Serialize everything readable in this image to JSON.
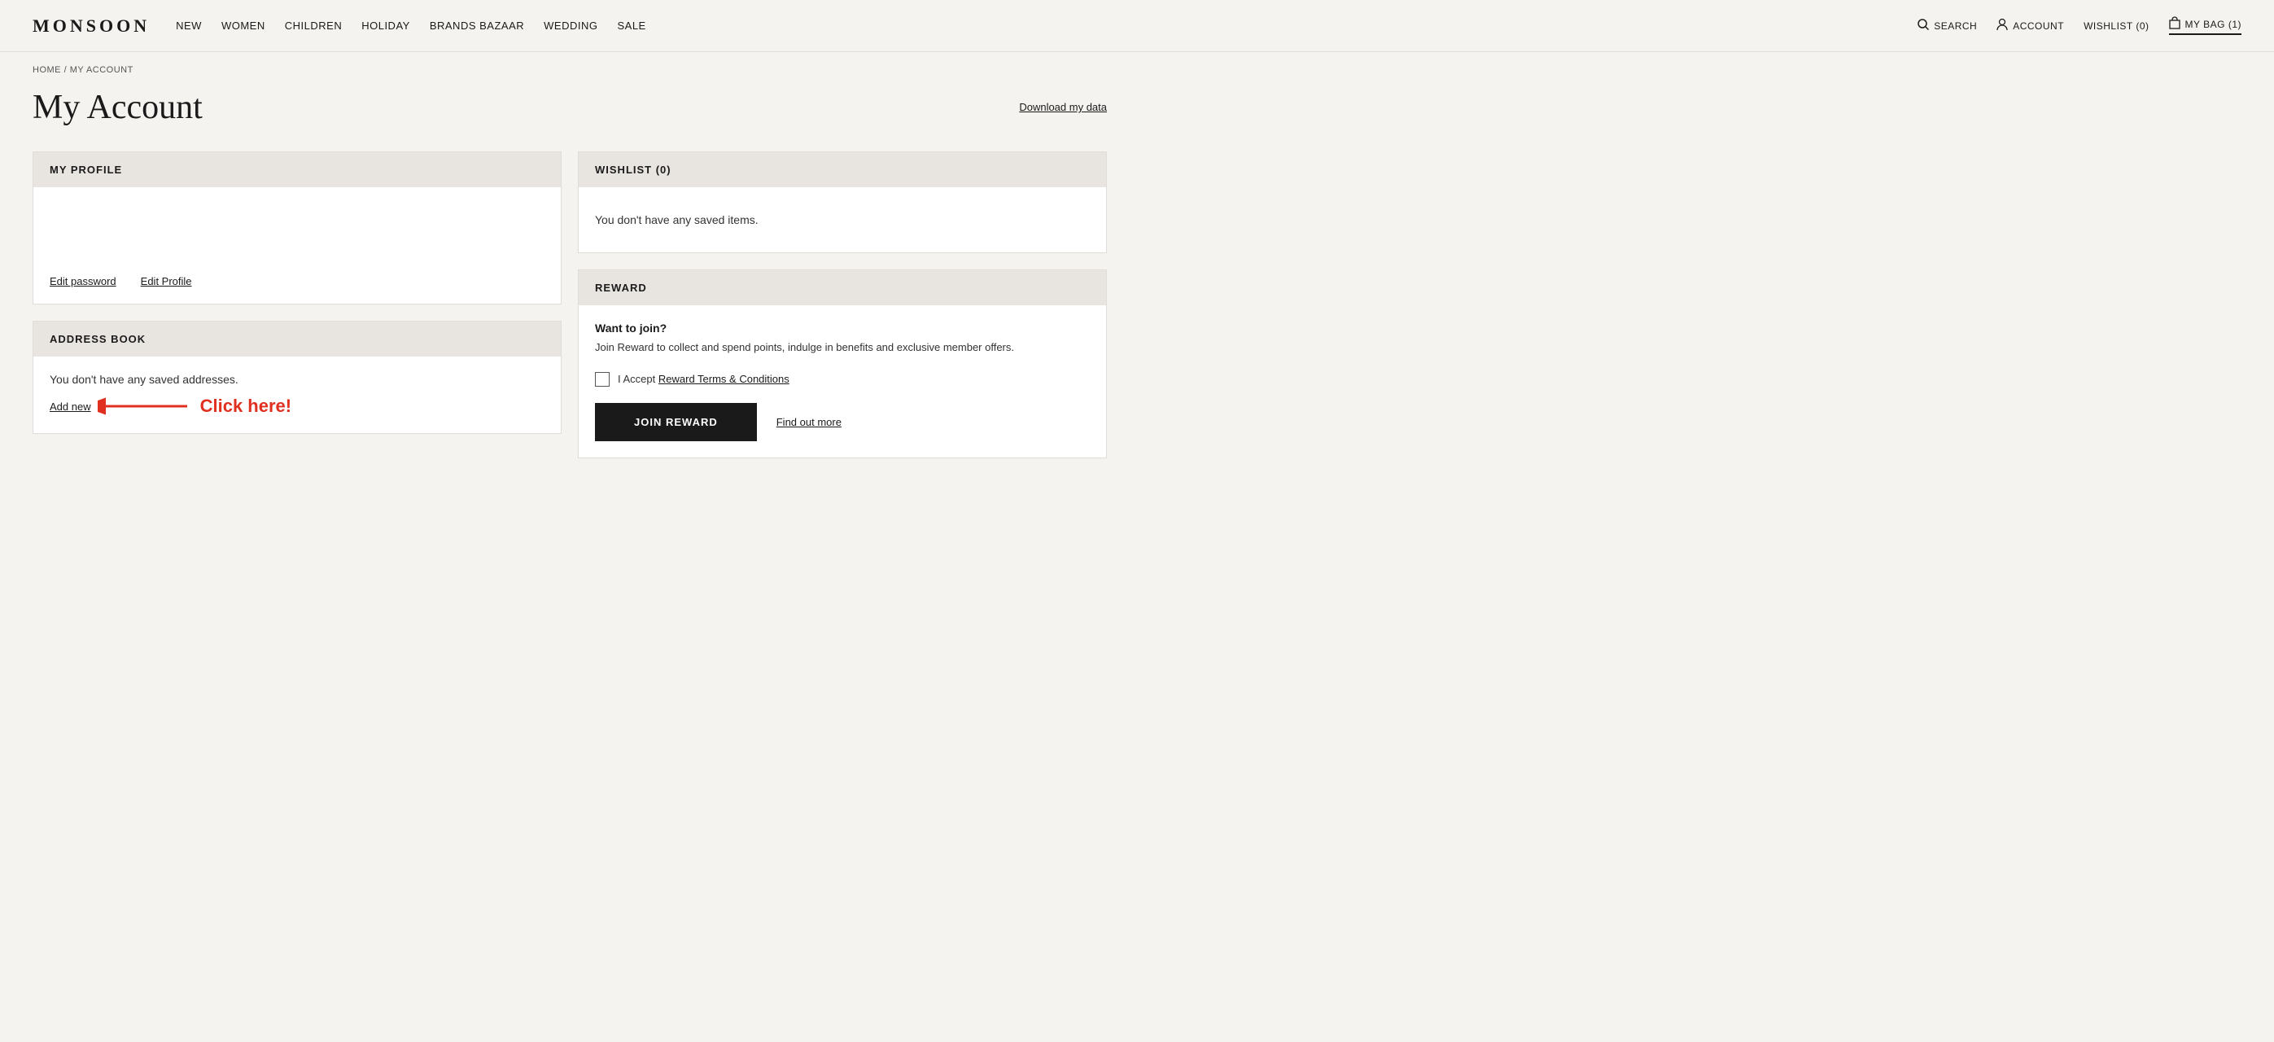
{
  "header": {
    "logo": "MONSOON",
    "nav_items": [
      "NEW",
      "WOMEN",
      "CHILDREN",
      "HOLIDAY",
      "BRANDS BAZAAR",
      "WEDDING",
      "SALE"
    ],
    "search_label": "SEARCH",
    "account_label": "ACCOUNT",
    "wishlist_label": "WISHLIST (0)",
    "bag_label": "MY BAG (1)"
  },
  "breadcrumb": {
    "home": "HOME",
    "separator": "/",
    "current": "MY ACCOUNT"
  },
  "page": {
    "title": "My Account",
    "download_link": "Download my data"
  },
  "profile_section": {
    "header": "MY PROFILE",
    "edit_password_label": "Edit password",
    "edit_profile_label": "Edit Profile"
  },
  "wishlist_section": {
    "header": "WISHLIST (0)",
    "empty_message": "You don't have any saved items."
  },
  "address_section": {
    "header": "ADDRESS BOOK",
    "empty_message": "You don't have any saved addresses.",
    "add_new_label": "Add new",
    "click_annotation": "Click here!"
  },
  "reward_section": {
    "header": "REWARD",
    "want_to_join": "Want to join?",
    "description": "Join Reward to collect and spend points, indulge in benefits and exclusive member offers.",
    "checkbox_label": "I Accept ",
    "terms_link_label": "Reward Terms & Conditions",
    "join_button_label": "JOIN REWARD",
    "find_out_more_label": "Find out more"
  }
}
